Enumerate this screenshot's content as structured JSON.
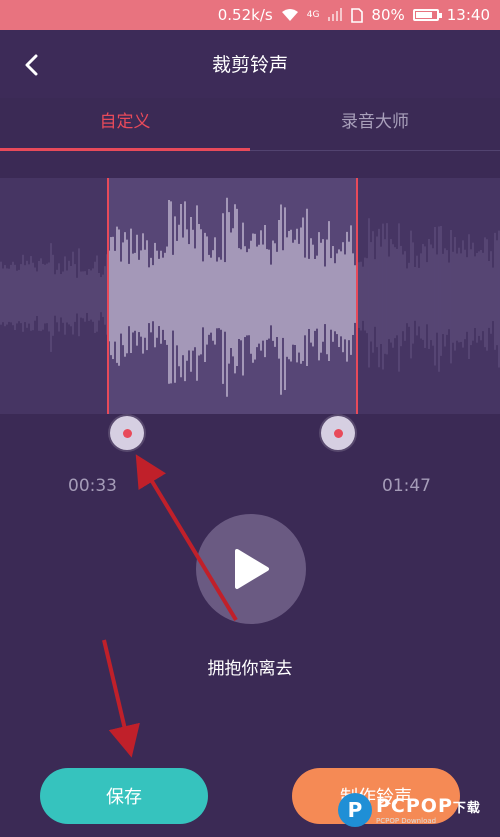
{
  "status_bar": {
    "speed": "0.52k/s",
    "network": "4G",
    "battery_text": "80%",
    "battery_level": 0.8,
    "time": "13:40",
    "bg_color": "#e8737f"
  },
  "header": {
    "title": "裁剪铃声",
    "back_icon": "chevron-left-icon"
  },
  "tabs": [
    {
      "label": "自定义",
      "active": true
    },
    {
      "label": "录音大师",
      "active": false
    }
  ],
  "trim": {
    "start_time": "00:33",
    "end_time": "01:47"
  },
  "player": {
    "play_icon": "play-icon",
    "song_title": "拥抱你离去"
  },
  "actions": {
    "save_label": "保存",
    "make_label": "制作铃声",
    "save_color": "#36c3be",
    "make_color": "#f58a55"
  },
  "watermark": {
    "logo_letter": "P",
    "text": "PCPOP",
    "suffix": "下载",
    "sub": "PCPOP Download"
  },
  "colors": {
    "background": "#3b2a55",
    "accent": "#e84a5a"
  }
}
